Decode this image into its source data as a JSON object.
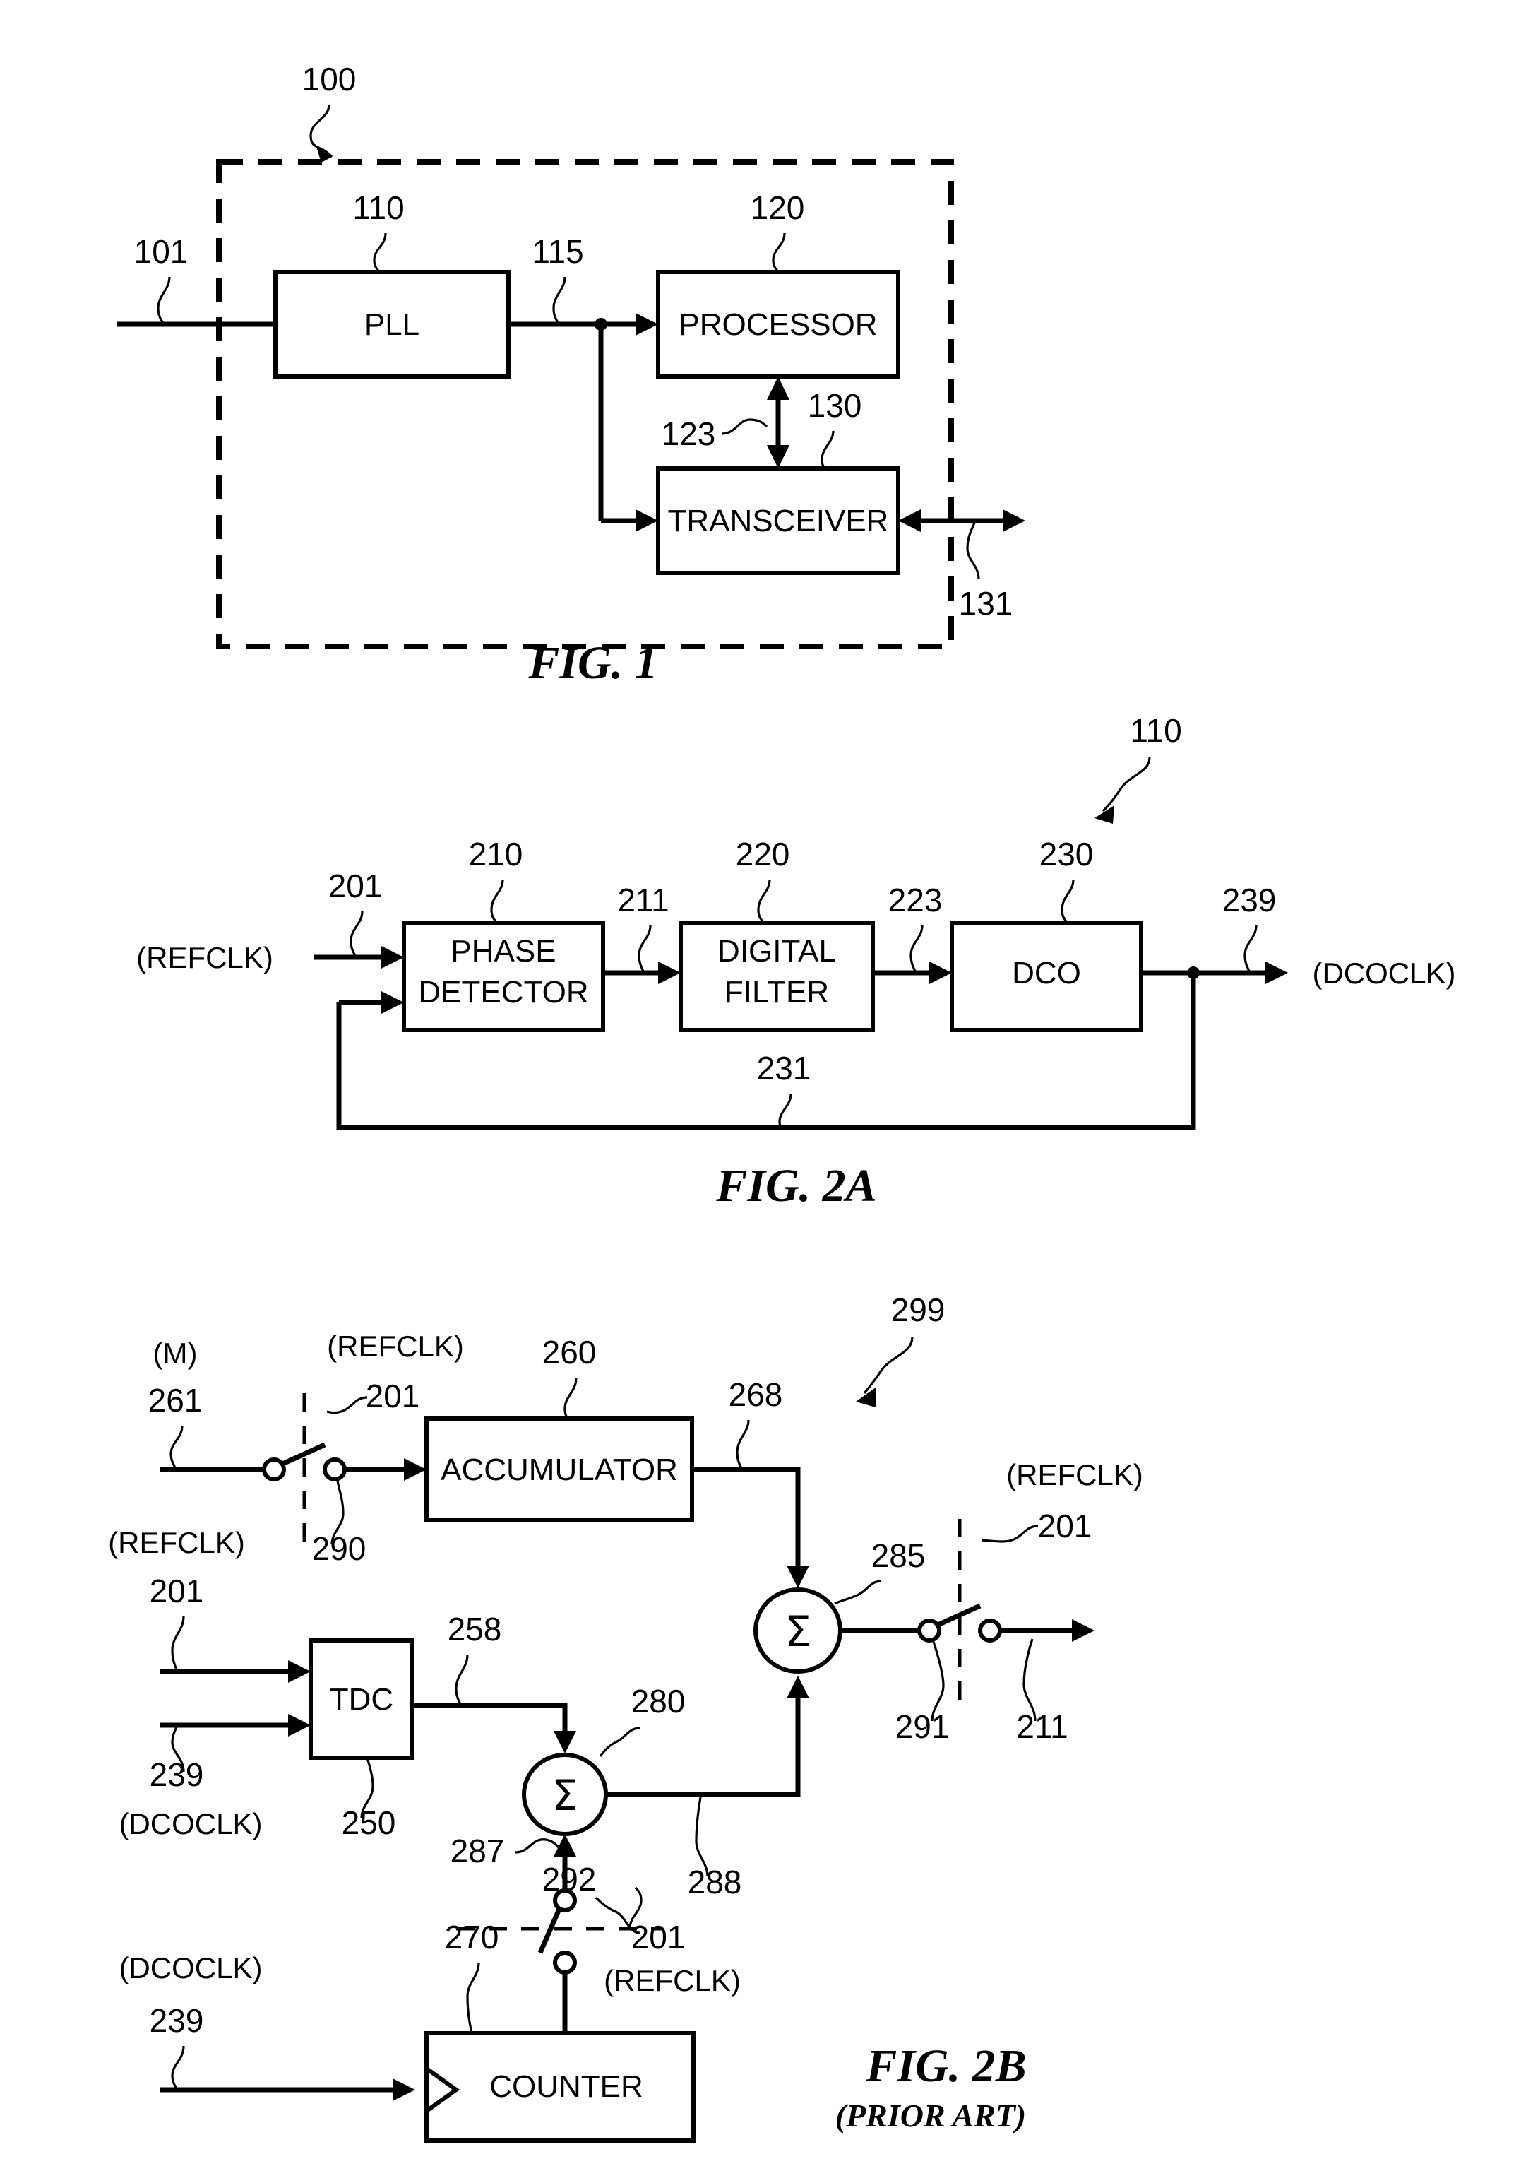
{
  "document": {
    "type": "patent-drawing-sheet",
    "figures": [
      "FIG. 1",
      "FIG. 2A",
      "FIG. 2B"
    ]
  },
  "fig1": {
    "caption": "FIG. 1",
    "system_ref": "100",
    "input_ref": "101",
    "blocks": [
      {
        "label": "PLL",
        "ref": "110"
      },
      {
        "label": "PROCESSOR",
        "ref": "120"
      },
      {
        "label": "TRANSCEIVER",
        "ref": "130"
      }
    ],
    "signals": [
      {
        "ref": "115",
        "desc": "pll-output"
      },
      {
        "ref": "123",
        "desc": "processor-transceiver-bus"
      },
      {
        "ref": "131",
        "desc": "antenna-port"
      }
    ]
  },
  "fig2a": {
    "caption": "FIG. 2A",
    "system_ref": "110",
    "input_label": "(REFCLK)",
    "input_ref": "201",
    "output_label": "(DCOCLK)",
    "output_ref": "239",
    "blocks": [
      {
        "label_line1": "PHASE",
        "label_line2": "DETECTOR",
        "ref": "210"
      },
      {
        "label_line1": "DIGITAL",
        "label_line2": "FILTER",
        "ref": "220"
      },
      {
        "label_line1": "DCO",
        "label_line2": "",
        "ref": "230"
      }
    ],
    "signals": [
      {
        "ref": "211",
        "desc": "phase-error"
      },
      {
        "ref": "223",
        "desc": "filter-output"
      },
      {
        "ref": "231",
        "desc": "feedback-path"
      }
    ]
  },
  "fig2b": {
    "caption": "FIG. 2B",
    "subcaption": "(PRIOR ART)",
    "system_ref": "299",
    "blocks": [
      {
        "label": "ACCUMULATOR",
        "ref": "260"
      },
      {
        "label": "TDC",
        "ref": "250"
      },
      {
        "label": "COUNTER",
        "ref": "270"
      }
    ],
    "adders": [
      {
        "symbol": "Σ",
        "ref": "285"
      },
      {
        "symbol": "Σ",
        "ref": "280"
      }
    ],
    "switches": [
      {
        "ref": "290",
        "clock": "(REFCLK)",
        "clock_ref": "201"
      },
      {
        "ref": "291",
        "clock": "(REFCLK)",
        "clock_ref": "201"
      },
      {
        "ref": "292",
        "clock_ref": "201",
        "clock": "(REFCLK)"
      }
    ],
    "inputs": [
      {
        "label": "(M)",
        "ref": "261"
      },
      {
        "label": "(REFCLK)",
        "ref": "201"
      },
      {
        "label": "(DCOCLK)",
        "ref": "239"
      },
      {
        "label": "(DCOCLK)",
        "ref": "239"
      }
    ],
    "signals": [
      {
        "ref": "268",
        "desc": "accumulator-output"
      },
      {
        "ref": "258",
        "desc": "tdc-output"
      },
      {
        "ref": "287",
        "desc": "counter-to-adder"
      },
      {
        "ref": "288",
        "desc": "adder280-output"
      },
      {
        "ref": "211",
        "desc": "phase-error-output"
      }
    ]
  }
}
